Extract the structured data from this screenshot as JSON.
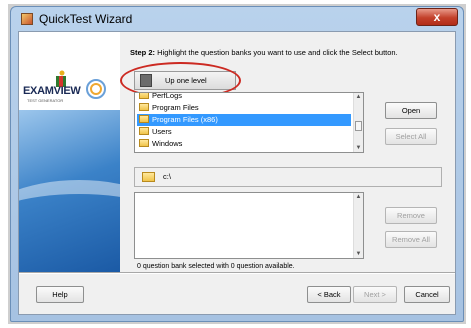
{
  "window": {
    "title": "QuickTest Wizard",
    "close_glyph": "x"
  },
  "logo": {
    "text": "EXAMVIEW",
    "sub": "TEST GENERATOR"
  },
  "step": {
    "label": "Step 2:",
    "instruction": "Highlight the question banks you want to use and click the Select button."
  },
  "up_level": {
    "label": "Up one level",
    "icon": "up-folder-icon"
  },
  "folders": [
    {
      "name": "PerfLogs",
      "selected": false
    },
    {
      "name": "Program Files",
      "selected": false
    },
    {
      "name": "Program Files (x86)",
      "selected": true
    },
    {
      "name": "Users",
      "selected": false
    },
    {
      "name": "Windows",
      "selected": false
    }
  ],
  "buttons": {
    "open": "Open",
    "select_all": "Select All",
    "remove": "Remove",
    "remove_all": "Remove All",
    "help": "Help",
    "back": "< Back",
    "next": "Next >",
    "cancel": "Cancel"
  },
  "path": {
    "value": "c:\\"
  },
  "status": "0 question bank selected with 0 question available.",
  "colors": {
    "highlight_ellipse": "#cc2a22",
    "selection": "#3399ff"
  }
}
